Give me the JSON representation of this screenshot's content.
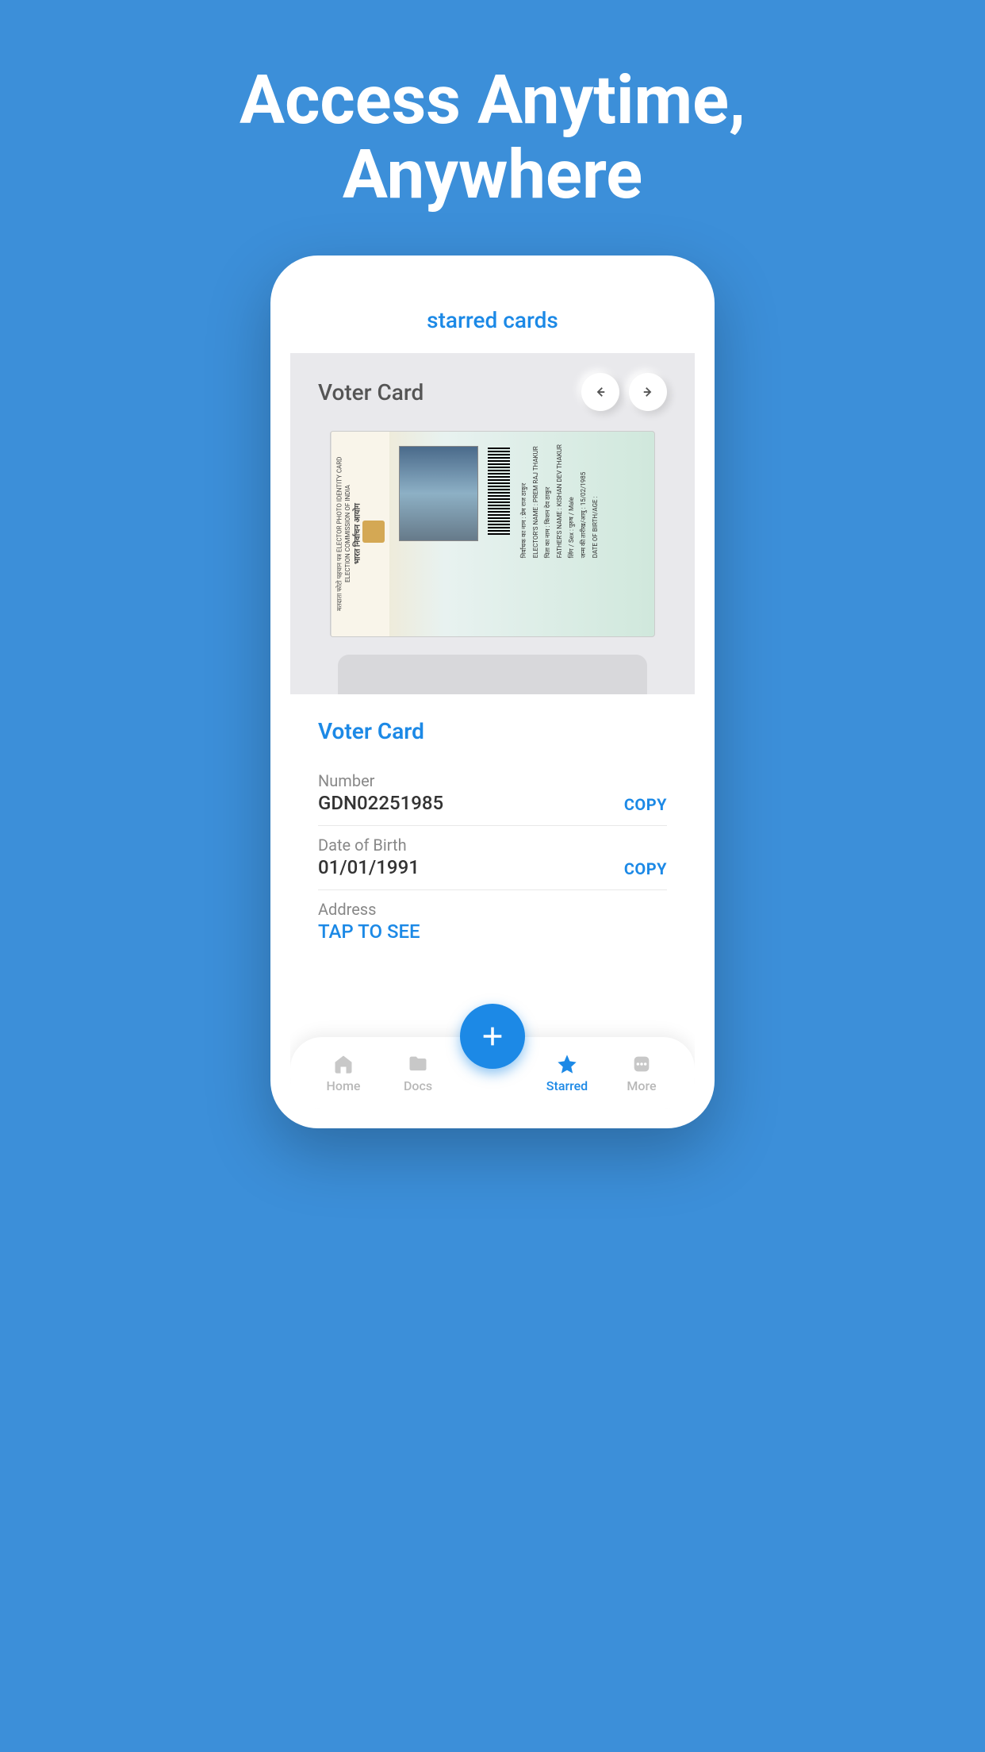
{
  "hero": {
    "title_line1": "Access Anytime,",
    "title_line2": "Anywhere"
  },
  "page": {
    "title": "starred cards"
  },
  "card": {
    "type_label": "Voter Card",
    "org_hindi": "भारत निर्वाचन आयोग",
    "org_en1": "ELECTION COMMISSION OF INDIA",
    "org_en2": "मतदाता फोटो पहचान पत्र  ELECTOR PHOTO IDENTITY CARD",
    "elector_hindi": "निर्वाचक का नाम : प्रेम राज ठाकुर",
    "elector_en": "ELECTOR'S NAME : PREM RAJ THAKUR",
    "father_hindi": "पिता का नाम : किशन देव ठाकुर",
    "father_en": "FATHER'S NAME : KISHAN DEV THAKUR",
    "sex": "लिंग / Sex : पुरुष / Male",
    "dob": "जन्म की तारीख/आयु : 15/02/1985",
    "dob_en": "DATE OF BIRTH/AGE :"
  },
  "details": {
    "title": "Voter Card",
    "rows": [
      {
        "label": "Number",
        "value": "GDN02251985",
        "copy": "COPY"
      },
      {
        "label": "Date of Birth",
        "value": "01/01/1991",
        "copy": "COPY"
      },
      {
        "label": "Address",
        "tap": "TAP TO SEE"
      }
    ]
  },
  "nav": {
    "items": [
      {
        "label": "Home",
        "active": false
      },
      {
        "label": "Docs",
        "active": false
      },
      {
        "label": "Starred",
        "active": true
      },
      {
        "label": "More",
        "active": false
      }
    ]
  }
}
